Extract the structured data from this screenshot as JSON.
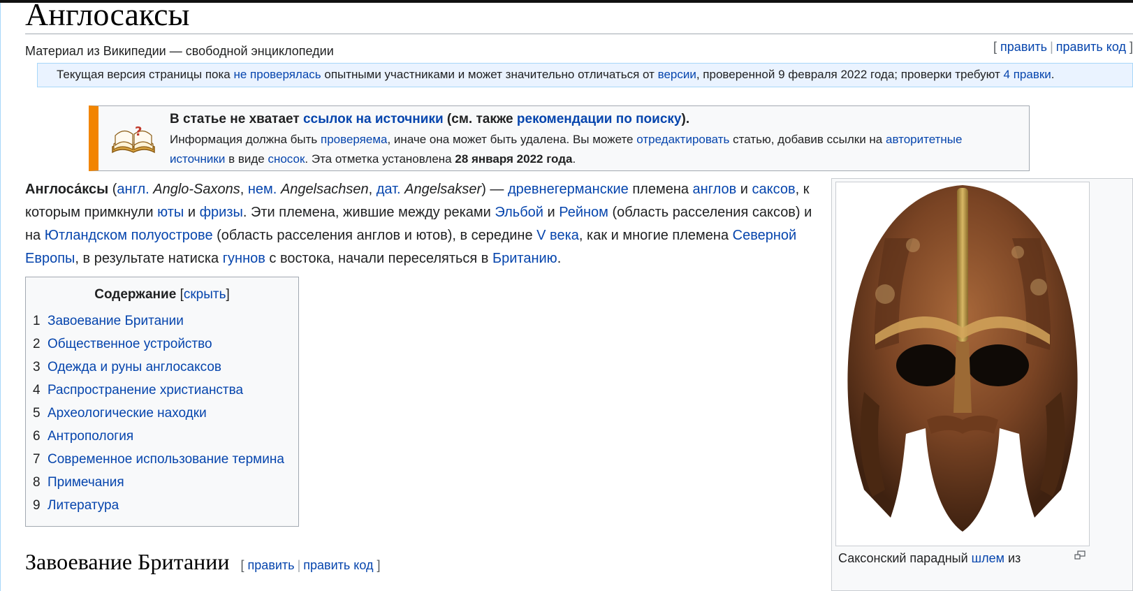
{
  "page": {
    "title": "Англосаксы",
    "site_sub": "Материал из Википедии — свободной энциклопедии"
  },
  "page_edit": {
    "open": "[",
    "edit": "править",
    "sep": "|",
    "edit_source": "править код",
    "close": "]"
  },
  "flagged_revs": {
    "t1": "Текущая версия страницы пока ",
    "l1": "не проверялась",
    "t2": " опытными участниками и может значительно отличаться от ",
    "l2": "версии",
    "t3": ", проверенной 9 февраля 2022 года; проверки требуют ",
    "l3": "4 правки",
    "t4": "."
  },
  "ambox": {
    "title_t1": "В статье не хватает ",
    "title_l1": "ссылок на источники",
    "title_t2": " (см. также ",
    "title_l2": "рекомендации по поиску",
    "title_t3": ").",
    "body_t1": "Информация должна быть ",
    "body_l1": "проверяема",
    "body_t2": ", иначе она может быть удалена. Вы можете ",
    "body_l2": "отредактировать",
    "body_t3": " статью, добавив ссылки на ",
    "body_l3": "авторитетные источники",
    "body_t4": " в виде ",
    "body_l4": "сносок",
    "body_t5": ". Эта отметка установлена ",
    "body_date": "28 января 2022 года",
    "body_t6": ".",
    "icon": "book-question-icon",
    "accent": "#f28500"
  },
  "lead": {
    "term": "Англоса́ксы",
    "t1": " (",
    "l_angl": "англ.",
    "t2": " ",
    "i1": "Anglo-Saxons",
    "t3": ", ",
    "l_nem": "нем.",
    "t4": " ",
    "i2": "Angelsachsen",
    "t5": ", ",
    "l_dat": "дат.",
    "t6": " ",
    "i3": "Angelsakser",
    "t7": ") — ",
    "l_drevn": "древнегерманские",
    "t8": " племена ",
    "l_anglov": "англов",
    "t9": " и ",
    "l_saksov": "саксов",
    "t10": ", к которым примкнули ",
    "l_yuty": "юты",
    "t11": " и ",
    "l_frizy": "фризы",
    "t12": ". Эти племена, жившие между реками ",
    "l_elba": "Эльбой",
    "t13": " и ",
    "l_rein": "Рейном",
    "t14": " (область расселения саксов) и на ",
    "l_jutland": "Ютландском полуострове",
    "t15": " (область расселения англов и ютов), в середине ",
    "l_vek": "V века",
    "t16": ", как и многие племена ",
    "l_europe": "Северной Европы",
    "t17": ", в результате натиска ",
    "l_gunny": "гуннов",
    "t18": " с востока, начали переселяться в ",
    "l_britain": "Британию",
    "t19": "."
  },
  "toc": {
    "title": "Содержание",
    "toggle_open": "[",
    "toggle": "скрыть",
    "toggle_close": "]",
    "items": [
      {
        "num": "1",
        "label": "Завоевание Британии"
      },
      {
        "num": "2",
        "label": "Общественное устройство"
      },
      {
        "num": "3",
        "label": "Одежда и руны англосаксов"
      },
      {
        "num": "4",
        "label": "Распространение христианства"
      },
      {
        "num": "5",
        "label": "Археологические находки"
      },
      {
        "num": "6",
        "label": "Антропология"
      },
      {
        "num": "7",
        "label": "Современное использование термина"
      },
      {
        "num": "8",
        "label": "Примечания"
      },
      {
        "num": "9",
        "label": "Литература"
      }
    ]
  },
  "section": {
    "heading": "Завоевание Британии",
    "edit_open": "[",
    "edit": "править",
    "sep": "|",
    "edit_source": "править код",
    "edit_close": "]"
  },
  "infobox": {
    "image": "sutton-hoo-helmet-image",
    "caption_t1": "Саксонский парадный ",
    "caption_link": "шлем",
    "caption_t2": " из",
    "magnify_icon": "magnify-icon"
  },
  "colors": {
    "link": "#0645ad",
    "text": "#202122",
    "toc_bg": "#f8f9fa",
    "flagged_bg": "#eaf3ff",
    "border": "#a2a9b1"
  }
}
